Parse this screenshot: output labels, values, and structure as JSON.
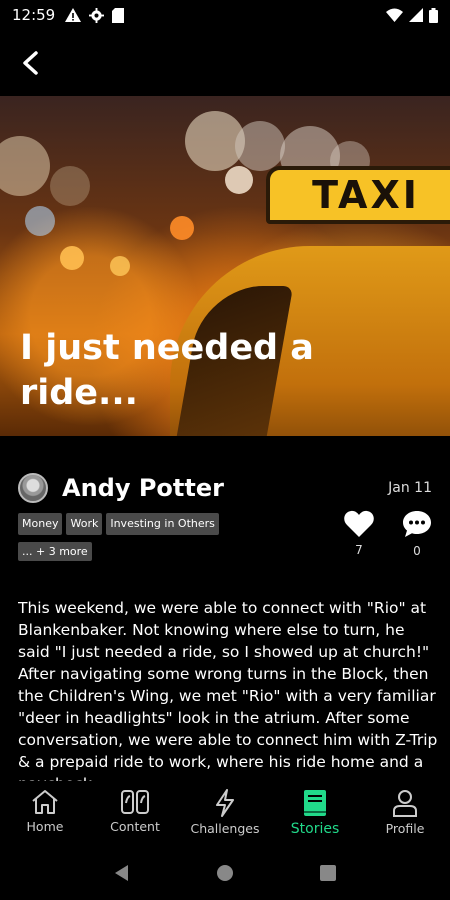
{
  "status_bar": {
    "time": "12:59"
  },
  "story": {
    "title": "I just needed a ride...",
    "image_sign_text": "TAXI",
    "author": "Andy Potter",
    "date": "Jan 11",
    "tags": [
      "Money",
      "Work",
      "Investing in Others"
    ],
    "more_tags": "... + 3 more",
    "likes": "7",
    "comments": "0",
    "body": "This weekend, we were able to connect with \"Rio\" at Blankenbaker. Not knowing where else to turn, he said \"I just needed a ride, so I showed up at church!\" After navigating some wrong turns in the Block, then the Children's Wing, we met \"Rio\" with a very familiar \"deer in headlights\" look in the atrium. After some conversation, we were able to connect him with Z-Trip & a prepaid ride to work, where his ride home and a paycheck"
  },
  "nav": {
    "items": [
      {
        "label": "Home",
        "icon": "home-icon"
      },
      {
        "label": "Content",
        "icon": "quote-icon"
      },
      {
        "label": "Challenges",
        "icon": "lightning-icon"
      },
      {
        "label": "Stories",
        "icon": "book-icon"
      },
      {
        "label": "Profile",
        "icon": "person-icon"
      }
    ],
    "active": "Stories"
  },
  "colors": {
    "accent": "#21d98a",
    "tag_bg": "#4a4a4a",
    "background": "#000000"
  }
}
